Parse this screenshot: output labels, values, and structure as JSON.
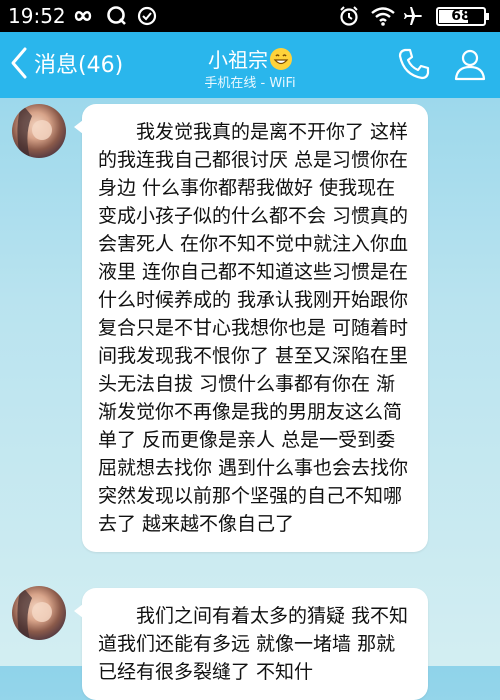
{
  "status_bar": {
    "time": "19:52",
    "battery_percent": "68",
    "battery_level": 0.68,
    "icons": [
      "infinity-icon",
      "q-icon",
      "sync-icon",
      "alarm-icon",
      "wifi-icon",
      "airplane-icon",
      "battery-icon"
    ]
  },
  "header": {
    "back_label": "消息(46)",
    "title": "小祖宗",
    "subtitle": "手机在线 - WiFi",
    "background": "#2ab6ec",
    "actions": [
      "phone-icon",
      "profile-icon"
    ]
  },
  "messages": [
    {
      "sender": "contact",
      "text": "我发觉我真的是离不开你了 这样的我连我自己都很讨厌 总是习惯你在身边 什么事你都帮我做好 使我现在变成小孩子似的什么都不会 习惯真的会害死人 在你不知不觉中就注入你血液里 连你自己都不知道这些习惯是在什么时候养成的 我承认我刚开始跟你复合只是不甘心我想你也是 可随着时间我发现我不恨你了 甚至又深陷在里头无法自拔 习惯什么事都有你在 渐渐发觉你不再像是我的男朋友这么简单了 反而更像是亲人 总是一受到委屈就想去找你 遇到什么事也会去找你 突然发现以前那个坚强的自己不知哪去了 越来越不像自己了"
    },
    {
      "sender": "contact",
      "text": "我们之间有着太多的猜疑 我不知道我们还能有多远 就像一堵墙 那就已经有很多裂缝了 不知什"
    }
  ]
}
